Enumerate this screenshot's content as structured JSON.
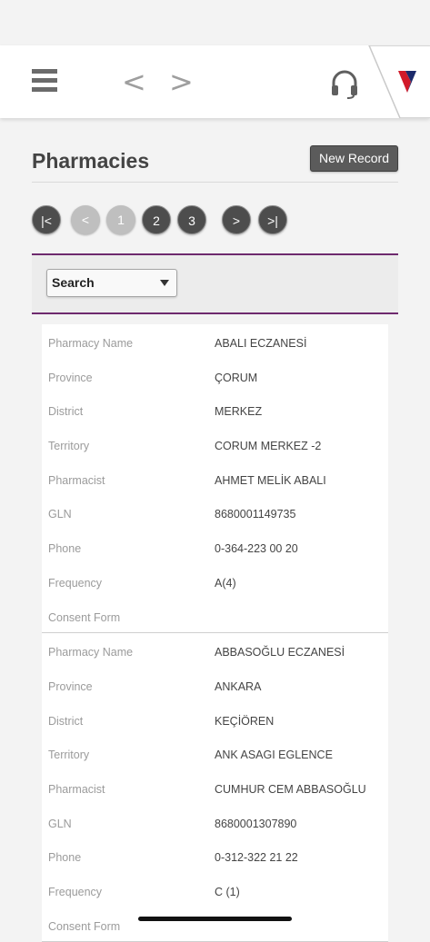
{
  "header": {
    "back_glyph": "<",
    "forward_glyph": ">",
    "brand_color": "#1b2a6b",
    "accent_color": "#d11a2a"
  },
  "page": {
    "title": "Pharmacies",
    "new_record_label": "New Record"
  },
  "pager": {
    "first": "|<",
    "prev": "<",
    "pages": [
      "1",
      "2",
      "3"
    ],
    "next": ">",
    "last": ">|"
  },
  "search": {
    "selected": "Search"
  },
  "records": [
    {
      "fields": [
        {
          "label": "Pharmacy Name",
          "value": "ABALI ECZANESİ"
        },
        {
          "label": "Province",
          "value": "ÇORUM"
        },
        {
          "label": "District",
          "value": "MERKEZ"
        },
        {
          "label": "Territory",
          "value": "CORUM MERKEZ -2"
        },
        {
          "label": "Pharmacist",
          "value": "AHMET MELİK ABALI"
        },
        {
          "label": "GLN",
          "value": "8680001149735"
        },
        {
          "label": "Phone",
          "value": "0-364-223 00 20"
        },
        {
          "label": "Frequency",
          "value": "A(4)"
        },
        {
          "label": "Consent Form",
          "value": ""
        }
      ]
    },
    {
      "fields": [
        {
          "label": "Pharmacy Name",
          "value": "ABBASOĞLU ECZANESİ"
        },
        {
          "label": "Province",
          "value": "ANKARA"
        },
        {
          "label": "District",
          "value": "KEÇİÖREN"
        },
        {
          "label": "Territory",
          "value": "ANK ASAGI EGLENCE"
        },
        {
          "label": "Pharmacist",
          "value": "CUMHUR CEM ABBASOĞLU"
        },
        {
          "label": "GLN",
          "value": "8680001307890"
        },
        {
          "label": "Phone",
          "value": "0-312-322 21 22"
        },
        {
          "label": "Frequency",
          "value": "C (1)"
        },
        {
          "label": "Consent Form",
          "value": ""
        }
      ]
    }
  ]
}
